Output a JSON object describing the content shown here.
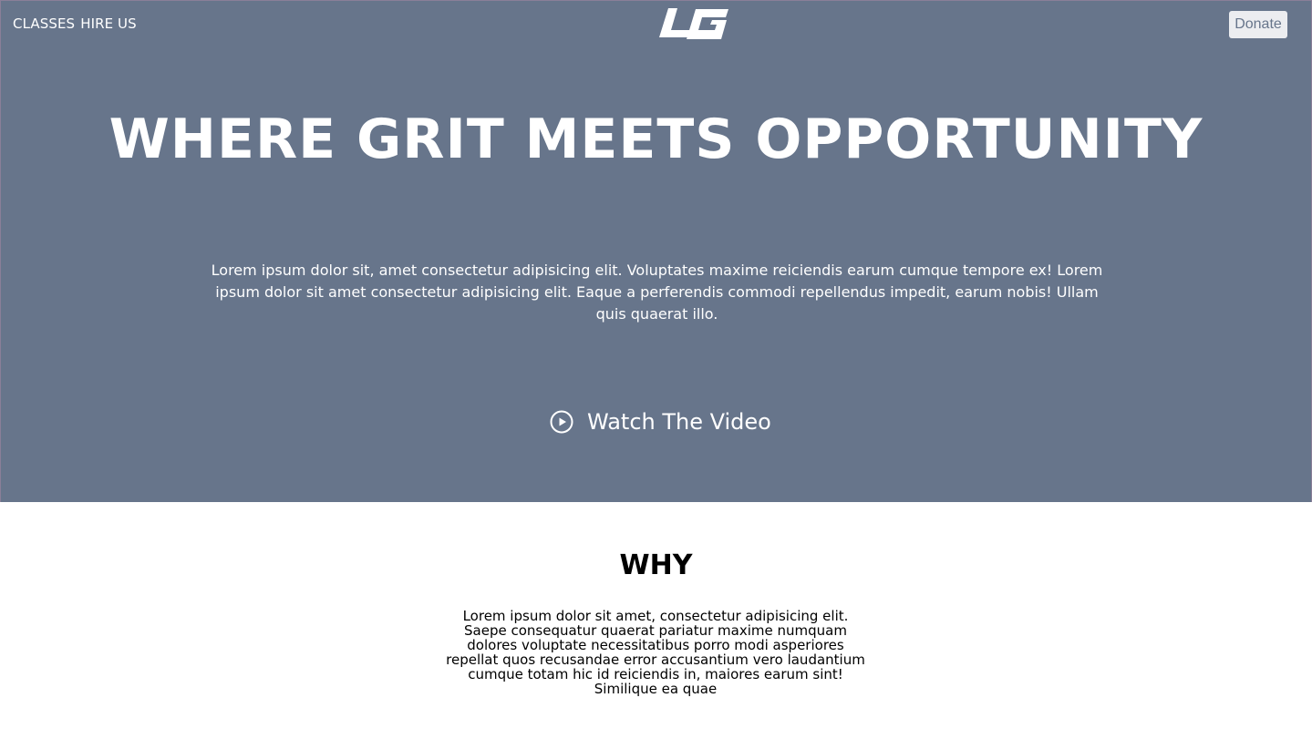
{
  "colors": {
    "hero_bg": "#67758b",
    "hero_text": "#ffffff",
    "donate_bg": "#ecedf0",
    "donate_text": "#67758b",
    "body_text": "#000000"
  },
  "nav": {
    "links": [
      "CLASSES",
      "HIRE US"
    ],
    "logo_text": "LG",
    "donate_label": "Donate"
  },
  "hero": {
    "headline": "WHERE GRIT MEETS OPPORTUNITY",
    "intro": "Lorem ipsum dolor sit, amet consectetur adipisicing elit. Voluptates maxime reiciendis earum cumque tempore ex! Lorem ipsum dolor sit amet consectetur adipisicing elit. Eaque a perferendis commodi repellendus impedit, earum nobis! Ullam quis quaerat illo.",
    "video_icon": "play-circle-icon",
    "video_label": "Watch The Video"
  },
  "why": {
    "title": "WHY",
    "text": "Lorem ipsum dolor sit amet, consectetur adipisicing elit. Saepe consequatur quaerat pariatur maxime numquam dolores voluptate necessitatibus porro modi asperiores repellat quos recusandae error accusantium vero laudantium cumque totam hic id reiciendis in, maiores earum sint! Similique ea quae"
  }
}
